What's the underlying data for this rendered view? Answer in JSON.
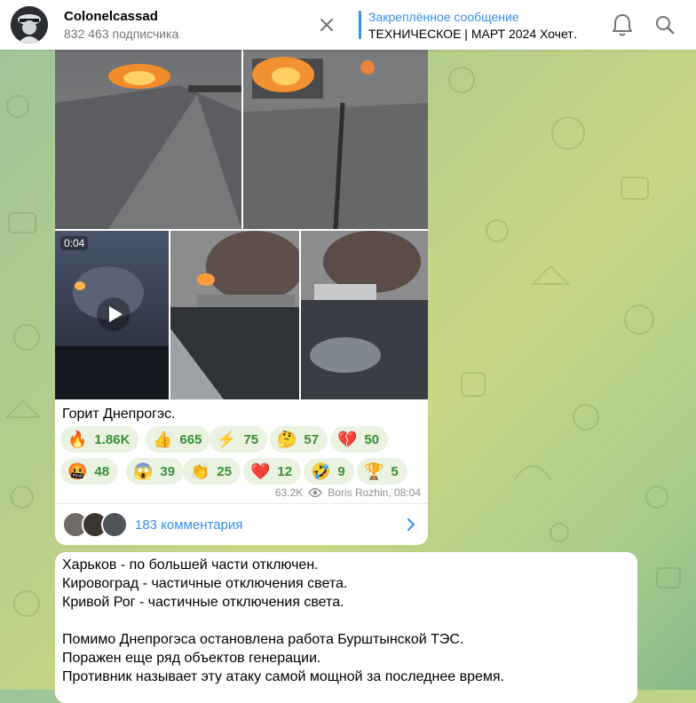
{
  "header": {
    "channel_name": "Colonelcassad",
    "subscribers": "832 463 подписчика",
    "pinned_label": "Закреплённое сообщение",
    "pinned_text": "ТЕХНИЧЕСКОЕ | МАРТ 2024 Хочет…"
  },
  "post1": {
    "video_duration": "0:04",
    "caption": "Горит Днепрогэс.",
    "reactions": [
      {
        "emoji": "🔥",
        "count": "1.86K"
      },
      {
        "emoji": "👍",
        "count": "665"
      },
      {
        "emoji": "⚡",
        "count": "75"
      },
      {
        "emoji": "🤔",
        "count": "57"
      },
      {
        "emoji": "💔",
        "count": "50"
      },
      {
        "emoji": "🤬",
        "count": "48"
      },
      {
        "emoji": "😱",
        "count": "39"
      },
      {
        "emoji": "👏",
        "count": "25"
      },
      {
        "emoji": "❤️",
        "count": "12"
      },
      {
        "emoji": "🤣",
        "count": "9"
      },
      {
        "emoji": "🏆",
        "count": "5"
      }
    ],
    "views": "63.2K",
    "author_time": "Boris Rozhin, 08:04",
    "comments_label": "183 комментария"
  },
  "post2": {
    "lines": [
      "Харьков - по большей части отключен.",
      "Кировоград - частичные отключения света.",
      "Кривой Рог - частичные отключения света.",
      "",
      "Помимо Днепрогэса остановлена работа Бурштынской ТЭС.",
      "Поражен еще ряд объектов генерации.",
      "Противник называет эту атаку самой мощной за последнее время."
    ]
  },
  "colors": {
    "accent": "#3390ec",
    "reaction_bg": "#eaf3e2",
    "reaction_text": "#3a8d35"
  }
}
